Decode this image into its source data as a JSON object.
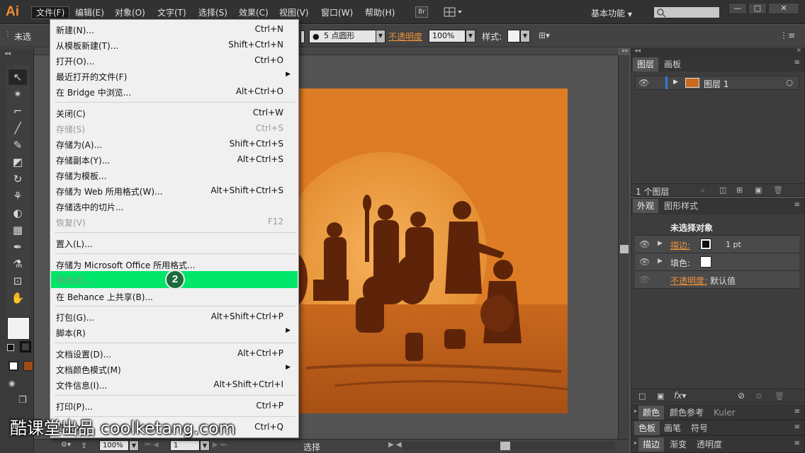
{
  "app": {
    "logo": "Ai"
  },
  "menubar": {
    "items": [
      "文件(F)",
      "编辑(E)",
      "对象(O)",
      "文字(T)",
      "选择(S)",
      "效果(C)",
      "视图(V)",
      "窗口(W)",
      "帮助(H)"
    ],
    "bridge_btn": "Br",
    "workspace": "基本功能"
  },
  "control_bar": {
    "no_selection": "未选",
    "brush": "5 点圆形",
    "opacity_label": "不透明度",
    "opacity_value": "100%",
    "style_label": "样式:"
  },
  "file_menu": {
    "items": [
      {
        "label": "新建(N)...",
        "shortcut": "Ctrl+N"
      },
      {
        "label": "从模板新建(T)...",
        "shortcut": "Shift+Ctrl+N"
      },
      {
        "label": "打开(O)...",
        "shortcut": "Ctrl+O"
      },
      {
        "label": "最近打开的文件(F)",
        "shortcut": ""
      },
      {
        "label": "在 Bridge 中浏览...",
        "shortcut": "Alt+Ctrl+O"
      },
      {
        "label": "关闭(C)",
        "shortcut": "Ctrl+W"
      },
      {
        "label": "存储(S)",
        "shortcut": "Ctrl+S"
      },
      {
        "label": "存储为(A)...",
        "shortcut": "Shift+Ctrl+S"
      },
      {
        "label": "存储副本(Y)...",
        "shortcut": "Alt+Ctrl+S"
      },
      {
        "label": "存储为模板...",
        "shortcut": ""
      },
      {
        "label": "存储为 Web 所用格式(W)...",
        "shortcut": "Alt+Shift+Ctrl+S"
      },
      {
        "label": "存储选中的切片...",
        "shortcut": ""
      },
      {
        "label": "恢复(V)",
        "shortcut": "F12"
      },
      {
        "label": "置入(L)...",
        "shortcut": ""
      },
      {
        "label": "存储为 Microsoft Office 所用格式...",
        "shortcut": ""
      },
      {
        "label": "导出(E)...",
        "shortcut": ""
      },
      {
        "label": "在 Behance 上共享(B)...",
        "shortcut": ""
      },
      {
        "label": "打包(G)...",
        "shortcut": "Alt+Shift+Ctrl+P"
      },
      {
        "label": "脚本(R)",
        "shortcut": ""
      },
      {
        "label": "文档设置(D)...",
        "shortcut": "Alt+Ctrl+P"
      },
      {
        "label": "文档颜色模式(M)",
        "shortcut": ""
      },
      {
        "label": "文件信息(I)...",
        "shortcut": "Alt+Shift+Ctrl+I"
      },
      {
        "label": "打印(P)...",
        "shortcut": "Ctrl+P"
      },
      {
        "label": "退出(X)",
        "shortcut": "Ctrl+Q"
      }
    ]
  },
  "step_badge": "2",
  "layers_panel": {
    "tabs": [
      "图层",
      "画板"
    ],
    "layer_name": "图层 1",
    "footer": "1 个图层"
  },
  "appearance_panel": {
    "tabs": [
      "外观",
      "图形样式"
    ],
    "header": "未选择对象",
    "stroke_label": "描边:",
    "stroke_value": "1 pt",
    "fill_label": "填色:",
    "opacity_label": "不透明度:",
    "opacity_value": "默认值"
  },
  "bottom_panels": {
    "row1": [
      "颜色",
      "颜色参考",
      "Kuler"
    ],
    "row2": [
      "色板",
      "画笔",
      "符号"
    ],
    "row3": [
      "描边",
      "渐变",
      "透明度"
    ]
  },
  "status_bar": {
    "zoom": "100%",
    "page": "1",
    "tool": "选择"
  },
  "watermark": "酷课堂出品 coolketang.com"
}
